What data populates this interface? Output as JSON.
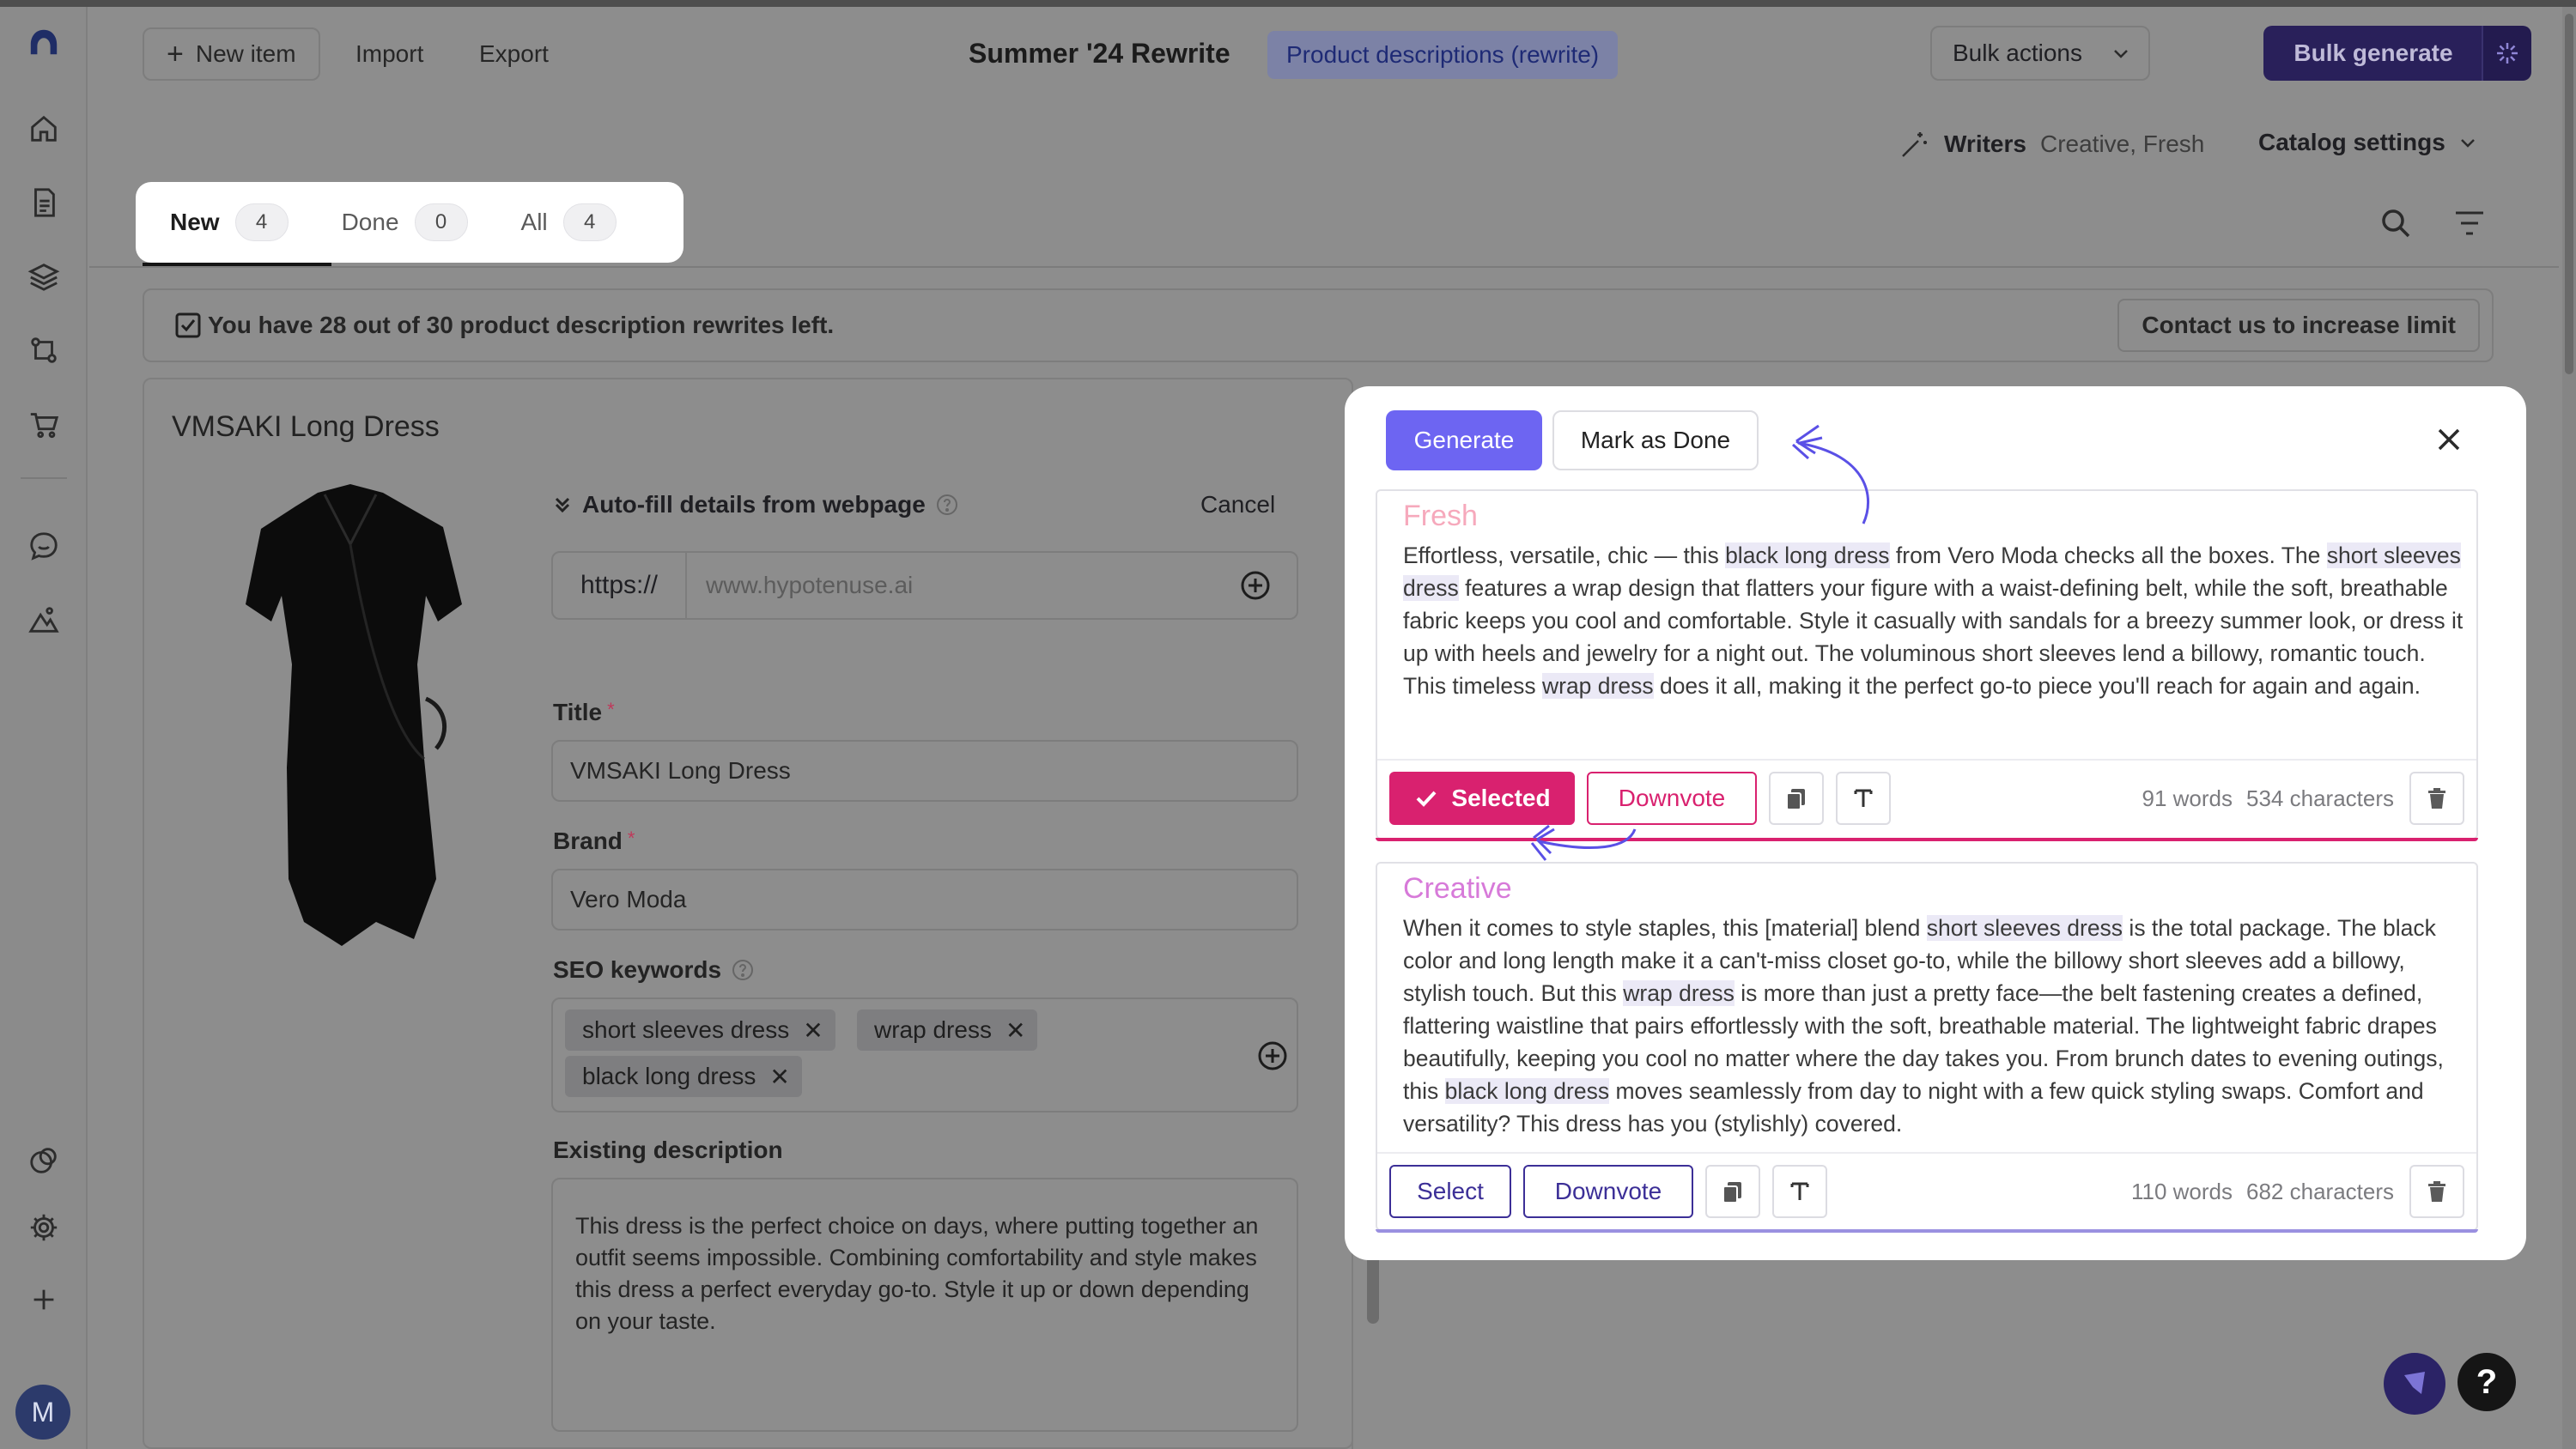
{
  "topbar": {
    "new_item": "New item",
    "import": "Import",
    "export": "Export",
    "project_title": "Summer '24 Rewrite",
    "project_pill": "Product descriptions (rewrite)",
    "bulk_actions": "Bulk actions",
    "bulk_generate": "Bulk generate"
  },
  "writers": {
    "label": "Writers",
    "value": "Creative, Fresh"
  },
  "catalog_settings": "Catalog settings",
  "tabs": [
    {
      "label": "New",
      "count": "4"
    },
    {
      "label": "Done",
      "count": "0"
    },
    {
      "label": "All",
      "count": "4"
    }
  ],
  "banner": {
    "text": "You have 28 out of 30 product description rewrites left.",
    "contact": "Contact us to increase limit"
  },
  "product": {
    "name": "VMSAKI Long Dress",
    "autofill_label": "Auto-fill details from webpage",
    "cancel": "Cancel",
    "url_prefix": "https://",
    "url_placeholder": "www.hypotenuse.ai",
    "title_label": "Title",
    "title_value": "VMSAKI Long Dress",
    "brand_label": "Brand",
    "brand_value": "Vero Moda",
    "seo_label": "SEO keywords",
    "keywords": [
      "short sleeves dress",
      "wrap dress",
      "black long dress"
    ],
    "existing_label": "Existing description",
    "existing_text": "This dress is the perfect choice on days, where putting together an outfit seems impossible. Combining comfortability and style makes this dress a perfect everyday go-to. Style it up or down depending on your taste."
  },
  "modal": {
    "generate": "Generate",
    "mark_done": "Mark as Done",
    "results": [
      {
        "writer": "Fresh",
        "color": "#f6a9bc",
        "text_parts": [
          [
            "Effortless, versatile, chic — this ",
            false
          ],
          [
            "black long dress",
            true
          ],
          [
            " from Vero Moda checks all the boxes. The ",
            false
          ],
          [
            "short sleeves dress",
            true
          ],
          [
            " features a wrap design that flatters your figure with a waist-defining belt, while the soft, breathable fabric keeps you cool and comfortable. Style it casually with sandals for a breezy summer look, or dress it up with heels and jewelry for a night out. The voluminous short sleeves lend a billowy, romantic touch. This timeless ",
            false
          ],
          [
            "wrap dress",
            true
          ],
          [
            " does it all, making it the perfect go-to piece you'll reach for again and again.",
            false
          ]
        ],
        "select_label": "Selected",
        "selected": true,
        "downvote": "Downvote",
        "words": "91 words",
        "characters": "534 characters"
      },
      {
        "writer": "Creative",
        "color": "#d77ad9",
        "text_parts": [
          [
            "When it comes to style staples, this [material] blend ",
            false
          ],
          [
            "short sleeves dress",
            true
          ],
          [
            " is the total package. The black color and long length make it a can't-miss closet go-to, while the billowy short sleeves add a billowy, stylish touch. But this ",
            false
          ],
          [
            "wrap dress",
            true
          ],
          [
            " is more than just a pretty face—the belt fastening creates a defined, flattering waistline that pairs effortlessly with the soft, breathable material. The lightweight fabric drapes beautifully, keeping you cool no matter where the day takes you. From brunch dates to evening outings, this ",
            false
          ],
          [
            "black long dress",
            true
          ],
          [
            " moves seamlessly from day to night with a few quick styling swaps. Comfort and versatility? This dress has you (stylishly) covered.",
            false
          ]
        ],
        "select_label": "Select",
        "selected": false,
        "downvote": "Downvote",
        "words": "110 words",
        "characters": "682 characters"
      }
    ]
  },
  "user_initial": "M",
  "help": "?"
}
